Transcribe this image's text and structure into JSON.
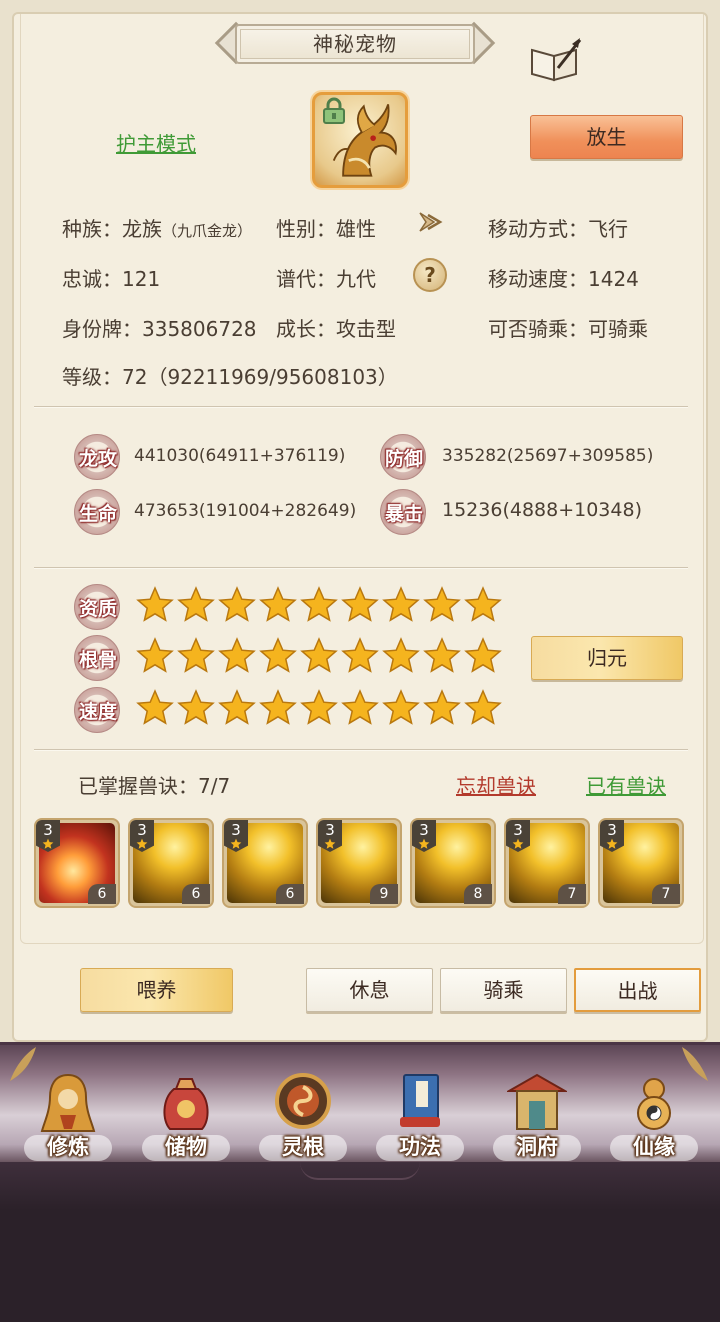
{
  "header": {
    "title": "神秘宠物"
  },
  "pet": {
    "mode_link": "护主模式",
    "release_label": "放生",
    "race_label": "种族：",
    "race_value": "龙族",
    "race_sub": "（九爪金龙）",
    "gender": "性别：雄性",
    "move_mode": "移动方式：飞行",
    "loyalty": "忠诚：121",
    "generation": "谱代：九代",
    "move_speed": "移动速度：1424",
    "id_tag": "身份牌：335806728",
    "growth": "成长：攻击型",
    "rideable": "可否骑乘：可骑乘",
    "level": "等级：72（92211969/95608103）"
  },
  "stats": [
    {
      "label": "龙攻",
      "value": "441030(64911+376119)"
    },
    {
      "label": "防御",
      "value": "335282(25697+309585)"
    },
    {
      "label": "生命",
      "value": "473653(191004+282649)"
    },
    {
      "label": "暴击",
      "value": "15236(4888+10348)"
    }
  ],
  "aptitudes": [
    {
      "label": "资质",
      "stars": 9
    },
    {
      "label": "根骨",
      "stars": 9
    },
    {
      "label": "速度",
      "stars": 9
    }
  ],
  "restore_label": "归元",
  "skills": {
    "mastered": "已掌握兽诀：7/7",
    "forget": "忘却兽诀",
    "owned": "已有兽诀",
    "items": [
      {
        "level": "3",
        "count": "6",
        "art": "fire"
      },
      {
        "level": "3",
        "count": "6",
        "art": "dragon"
      },
      {
        "level": "3",
        "count": "6",
        "art": "dragon"
      },
      {
        "level": "3",
        "count": "9",
        "art": "dragon"
      },
      {
        "level": "3",
        "count": "8",
        "art": "dragon"
      },
      {
        "level": "3",
        "count": "7",
        "art": "dragon"
      },
      {
        "level": "3",
        "count": "7",
        "art": "dragon"
      }
    ]
  },
  "actions": {
    "feed": "喂养",
    "rest": "休息",
    "ride": "骑乘",
    "battle": "出战"
  },
  "nav": [
    {
      "label": "修炼",
      "icon": "cultivate-icon"
    },
    {
      "label": "储物",
      "icon": "storage-bag-icon"
    },
    {
      "label": "灵根",
      "icon": "spirit-root-icon"
    },
    {
      "label": "功法",
      "icon": "scripture-book-icon"
    },
    {
      "label": "洞府",
      "icon": "cave-mansion-icon"
    },
    {
      "label": "仙缘",
      "icon": "gourd-icon"
    }
  ],
  "colors": {
    "accent_orange": "#f0905a",
    "link_green": "#3f9a36",
    "link_red": "#b33a2c",
    "star_gold": "#f5b41e"
  }
}
